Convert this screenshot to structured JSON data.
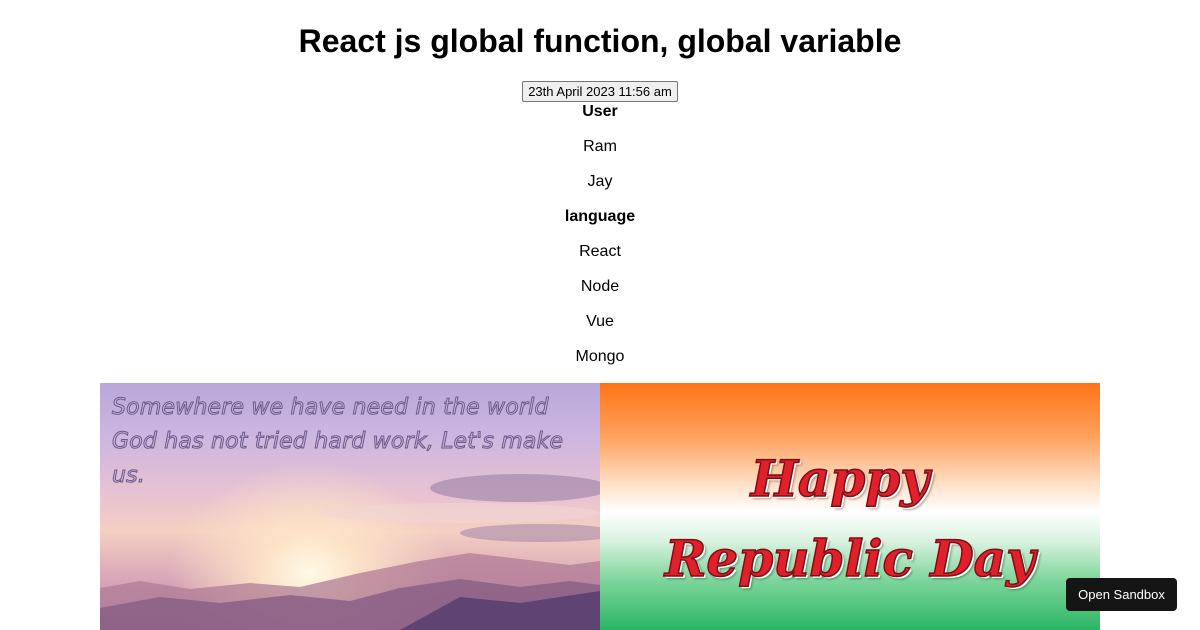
{
  "page": {
    "title": "React js global function, global variable",
    "date_button_label": "23th April 2023 11:56 am"
  },
  "lists": {
    "user_heading": "User",
    "users": [
      "Ram",
      "Jay"
    ],
    "language_heading": "language",
    "languages": [
      "React",
      "Node",
      "Vue",
      "Mongo"
    ]
  },
  "banners": {
    "left": {
      "quote_line_1": "Somewhere we have need in the world",
      "quote_line_2": "God has not tried hard work, Let's make us."
    },
    "right": {
      "greeting_line_1": "Happy",
      "greeting_line_2": "Republic Day"
    }
  },
  "sandbox": {
    "open_label": "Open Sandbox"
  },
  "colors": {
    "saffron": "#ff7315",
    "green": "#2bb565",
    "greeting_red": "#e0212b",
    "sandbox_bg": "#151515"
  }
}
